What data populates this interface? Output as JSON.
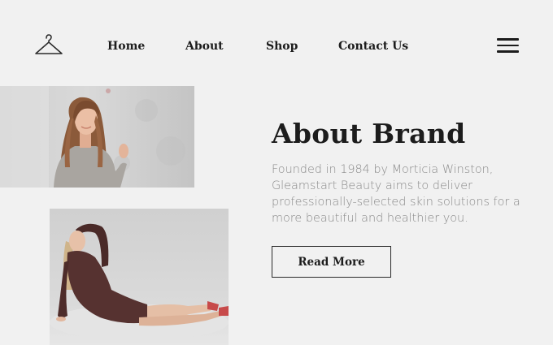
{
  "header": {
    "logo_icon": "hanger-icon",
    "nav": [
      {
        "label": "Home"
      },
      {
        "label": "About"
      },
      {
        "label": "Shop"
      },
      {
        "label": "Contact Us"
      }
    ],
    "menu_icon": "hamburger-menu-icon"
  },
  "about": {
    "title": "About Brand",
    "description": "Founded in 1984 by Morticia Winston, Gleamstart Beauty aims to deliver professionally-selected skin solutions for a more beautiful and healthier you.",
    "button_label": "Read More"
  },
  "images": [
    {
      "subject": "woman-in-grey-sweater-photo"
    },
    {
      "subject": "woman-in-brown-dress-photo"
    }
  ],
  "colors": {
    "background": "#f1f1f1",
    "text": "#1c1c1c",
    "muted_text": "#8a8a8a"
  }
}
